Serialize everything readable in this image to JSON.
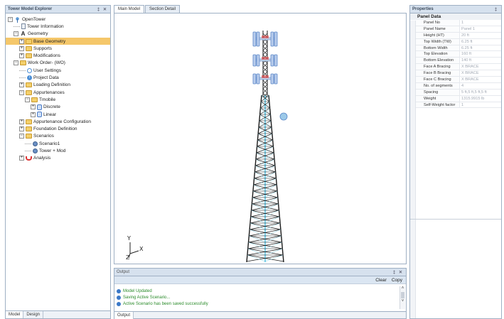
{
  "explorer": {
    "title": "Tower Model Explorer",
    "pin_icon": "‡",
    "close_icon": "✕",
    "tree": [
      {
        "indent": 0,
        "expander": "−",
        "icon": "root",
        "label": "OpenTower"
      },
      {
        "indent": 1,
        "expander": "",
        "icon": "doc",
        "label": "Tower Information"
      },
      {
        "indent": 1,
        "expander": "−",
        "icon": "geometry",
        "label": "Geometry"
      },
      {
        "indent": 2,
        "expander": "+",
        "icon": "folder",
        "label": "Base Geometry",
        "selected": true
      },
      {
        "indent": 2,
        "expander": "+",
        "icon": "folder",
        "label": "Supports"
      },
      {
        "indent": 2,
        "expander": "+",
        "icon": "folder",
        "label": "Modifications"
      },
      {
        "indent": 1,
        "expander": "−",
        "icon": "folder",
        "label": "Work Order- (WO)"
      },
      {
        "indent": 2,
        "expander": "",
        "icon": "gear",
        "label": "User Settings"
      },
      {
        "indent": 2,
        "expander": "",
        "icon": "info",
        "label": "Project Data"
      },
      {
        "indent": 2,
        "expander": "+",
        "icon": "folder",
        "label": "Loading Definition"
      },
      {
        "indent": 2,
        "expander": "−",
        "icon": "folder",
        "label": "Appurtenances"
      },
      {
        "indent": 3,
        "expander": "−",
        "icon": "folder",
        "label": "Tmobile"
      },
      {
        "indent": 4,
        "expander": "+",
        "icon": "antenna",
        "label": "Discrete"
      },
      {
        "indent": 4,
        "expander": "+",
        "icon": "antenna",
        "label": "Linear"
      },
      {
        "indent": 2,
        "expander": "+",
        "icon": "folder",
        "label": "Appurtenance Configuration"
      },
      {
        "indent": 2,
        "expander": "+",
        "icon": "folder",
        "label": "Foundation Definition"
      },
      {
        "indent": 2,
        "expander": "−",
        "icon": "folder",
        "label": "Scenarios"
      },
      {
        "indent": 3,
        "expander": "",
        "icon": "scen",
        "label": "Scenario1"
      },
      {
        "indent": 3,
        "expander": "",
        "icon": "scen",
        "label": "Tower + Mod"
      },
      {
        "indent": 2,
        "expander": "+",
        "icon": "analysis",
        "label": "Analysis"
      }
    ],
    "bottom_tabs": [
      "Model",
      "Design"
    ]
  },
  "document_tabs": [
    {
      "label": "Main Model",
      "active": true
    },
    {
      "label": "Section Detail",
      "active": false
    }
  ],
  "viewport": {
    "axis": {
      "y": "Y",
      "x": "X",
      "z": "Z"
    },
    "colors": {
      "lattice": "#1a1a1a",
      "leg": "#7fd0e8",
      "antenna": "#5a86c8",
      "accent": "#e05050"
    }
  },
  "output": {
    "title": "Output",
    "pin_icon": "‡",
    "close_icon": "✕",
    "toolbar": {
      "clear": "Clear",
      "copy": "Copy"
    },
    "messages": [
      {
        "text": "Model Updated"
      },
      {
        "text": "Saving Active Scenario..."
      },
      {
        "text": "Active Scenario has been saved successfully"
      }
    ],
    "scroll_up": "˄",
    "scroll_down": "˅",
    "tab": "Output"
  },
  "properties": {
    "title": "Properties",
    "pin_icon": "‡",
    "section": "Panel Data",
    "rows": [
      {
        "key": "Panel No",
        "value": "1"
      },
      {
        "key": "Panel Name",
        "value": "Panel 1"
      },
      {
        "key": "Height (HT)",
        "value": "20 ft"
      },
      {
        "key": "Top Width (TW)",
        "value": "6.25 ft"
      },
      {
        "key": "Bottom Width",
        "value": "6.25 ft"
      },
      {
        "key": "Top Elevation",
        "value": "160 ft"
      },
      {
        "key": "Bottom Elevation",
        "value": "140 ft"
      },
      {
        "key": "Face A Bracing",
        "value": "X BRACE"
      },
      {
        "key": "Face B Bracing",
        "value": "X BRACE"
      },
      {
        "key": "Face C Bracing",
        "value": "X BRACE"
      },
      {
        "key": "No. of segments",
        "value": "4"
      },
      {
        "key": "Spacing",
        "value": "5 ft,5 ft,5 ft,5 ft"
      },
      {
        "key": "Weight",
        "value": "1315.9915 lb"
      },
      {
        "key": "Self-Weight factor",
        "value": "1"
      }
    ]
  }
}
